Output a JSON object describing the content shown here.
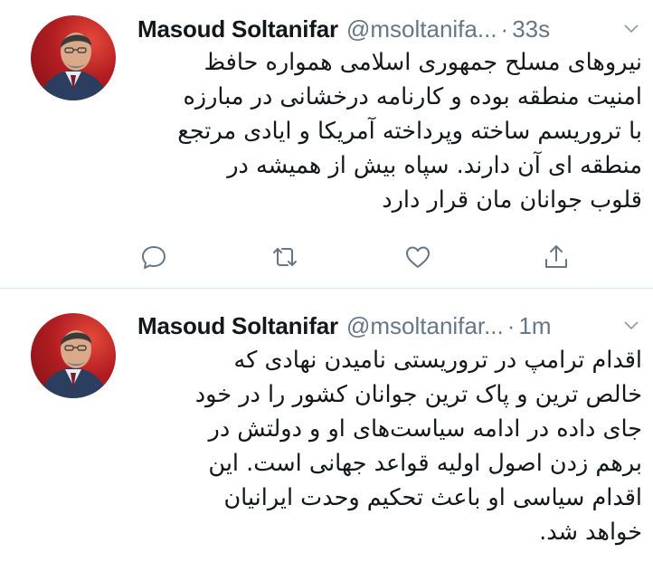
{
  "colors": {
    "text": "#14171a",
    "secondary": "#657786",
    "divider": "#e1e8ed"
  },
  "tweets": [
    {
      "author_name": "Masoud Soltanifar",
      "handle": "@msoltanifa...",
      "separator": "·",
      "time": "33s",
      "text": "نیروهای مسلح جمهوری اسلامی همواره حافظ\nامنیت منطقه بوده و کارنامه درخشانی در مبارزه\nبا تروریسم ساخته وپرداخته آمریکا و ایادی مرتجع\nمنطقه ای آن دارند. سپاه بیش از همیشه در\nقلوب جوانان مان قرار دارد",
      "actions": [
        "reply-icon",
        "retweet-icon",
        "like-icon",
        "share-icon"
      ]
    },
    {
      "author_name": "Masoud Soltanifar",
      "handle": "@msoltanifar...",
      "separator": "·",
      "time": "1m",
      "text": "اقدام ترامپ در تروریستی نامیدن نهادی که\nخالص ترین و پاک ترین جوانان کشور را در خود\nجای داده در ادامه سیاست‌های او و دولتش در\nبرهم زدن اصول اولیه قواعد جهانی است. این\nاقدام سیاسی او باعث تحکیم وحدت ایرانیان\nخواهد شد."
    }
  ]
}
